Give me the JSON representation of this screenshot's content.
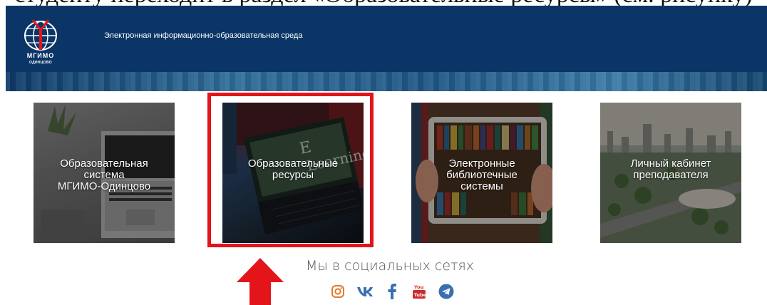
{
  "slide_caption": "студенту переходит в раздел «Образовательные ресурсы» (см. рисунку)",
  "header": {
    "logo_text": "МГИМО",
    "logo_subtext": "ОДИНЦОВО",
    "title": "Электронная информационно-образовательная среда"
  },
  "tiles": [
    {
      "lines": [
        "Образовательная",
        "система",
        "МГИМО-Одинцово"
      ]
    },
    {
      "lines": [
        "Образовательные",
        "ресурсы"
      ]
    },
    {
      "lines": [
        "Электронные",
        "библиотечные",
        "системы"
      ]
    },
    {
      "lines": [
        "Личный кабинет",
        "преподавателя"
      ]
    }
  ],
  "social": {
    "heading": "Мы в социальных сетях",
    "icons": [
      "instagram-icon",
      "vk-icon",
      "facebook-icon",
      "youtube-icon",
      "telegram-icon"
    ]
  },
  "colors": {
    "header_bg": "#0b3566",
    "highlight": "#e4141b",
    "social_icon": "#e07a2e",
    "social_icon_blue": "#3a6fb0"
  }
}
